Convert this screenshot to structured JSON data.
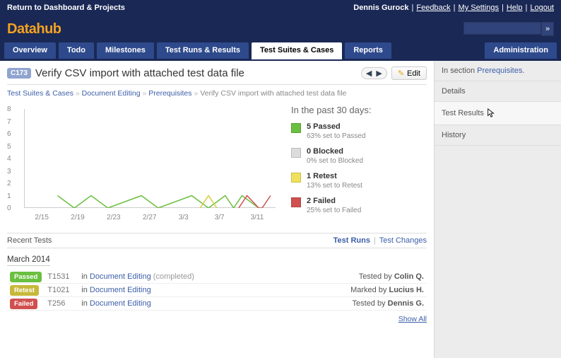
{
  "topbar": {
    "return": "Return to Dashboard & Projects",
    "user": "Dennis Gurock",
    "feedback": "Feedback",
    "settings": "My Settings",
    "help": "Help",
    "logout": "Logout"
  },
  "brand": "Datahub",
  "search": {
    "placeholder": "",
    "go": "»"
  },
  "tabs": {
    "overview": "Overview",
    "todo": "Todo",
    "milestones": "Milestones",
    "runs": "Test Runs & Results",
    "suites": "Test Suites & Cases",
    "reports": "Reports",
    "admin": "Administration"
  },
  "case": {
    "id": "C173",
    "title": "Verify CSV import with attached test data file",
    "edit": "Edit"
  },
  "breadcrumbs": {
    "a": "Test Suites & Cases",
    "b": "Document Editing",
    "c": "Prerequisites",
    "d": "Verify CSV import with attached test data file"
  },
  "chart_data": {
    "type": "line",
    "title": "",
    "ylabel": "",
    "xlabel": "",
    "ylim": [
      0,
      8
    ],
    "yticks": [
      0,
      1,
      2,
      3,
      4,
      5,
      6,
      7,
      8
    ],
    "categories": [
      "2/15",
      "2/19",
      "2/23",
      "2/27",
      "3/3",
      "3/7",
      "3/11"
    ],
    "series": [
      {
        "name": "Passed",
        "color": "#6abf40",
        "points": [
          [
            2,
            1
          ],
          [
            3,
            0
          ],
          [
            4,
            1
          ],
          [
            5,
            0
          ],
          [
            7,
            1
          ],
          [
            8,
            0
          ],
          [
            10,
            1
          ],
          [
            11,
            0
          ],
          [
            12,
            1
          ],
          [
            12.5,
            0
          ],
          [
            13,
            1
          ],
          [
            14,
            0
          ]
        ]
      },
      {
        "name": "Retest",
        "color": "#d8cc3f",
        "points": [
          [
            10.5,
            0
          ],
          [
            11,
            1
          ],
          [
            11.5,
            0
          ]
        ]
      },
      {
        "name": "Failed",
        "color": "#d05050",
        "points": [
          [
            12.8,
            0
          ],
          [
            13.3,
            1
          ],
          [
            14,
            0
          ],
          [
            14.2,
            0
          ],
          [
            14.7,
            1
          ]
        ]
      }
    ]
  },
  "stats": {
    "heading": "In the past 30 days:",
    "items": [
      {
        "label": "5 Passed",
        "sub": "63% set to Passed",
        "color": "#6abf40"
      },
      {
        "label": "0 Blocked",
        "sub": "0% set to Blocked",
        "color": "#dcdcdc"
      },
      {
        "label": "1 Retest",
        "sub": "13% set to Retest",
        "color": "#efe15a"
      },
      {
        "label": "2 Failed",
        "sub": "25% set to Failed",
        "color": "#d05050"
      }
    ]
  },
  "recent": {
    "title": "Recent Tests",
    "link_runs": "Test Runs",
    "link_changes": "Test Changes",
    "month": "March 2014",
    "rows": [
      {
        "status": "Passed",
        "color": "#6abf40",
        "tid": "T1531",
        "in": "in",
        "suite": "Document Editing",
        "extra": "(completed)",
        "by_prefix": "Tested by",
        "by": "Colin Q."
      },
      {
        "status": "Retest",
        "color": "#c7b83a",
        "tid": "T1021",
        "in": "in",
        "suite": "Document Editing",
        "extra": "",
        "by_prefix": "Marked by",
        "by": "Lucius H."
      },
      {
        "status": "Failed",
        "color": "#d05050",
        "tid": "T256",
        "in": "in",
        "suite": "Document Editing",
        "extra": "",
        "by_prefix": "Tested by",
        "by": "Dennis G."
      }
    ],
    "showall": "Show All"
  },
  "side": {
    "insection": "In section",
    "insection_link": "Prerequisites",
    "details": "Details",
    "results": "Test Results",
    "history": "History"
  }
}
